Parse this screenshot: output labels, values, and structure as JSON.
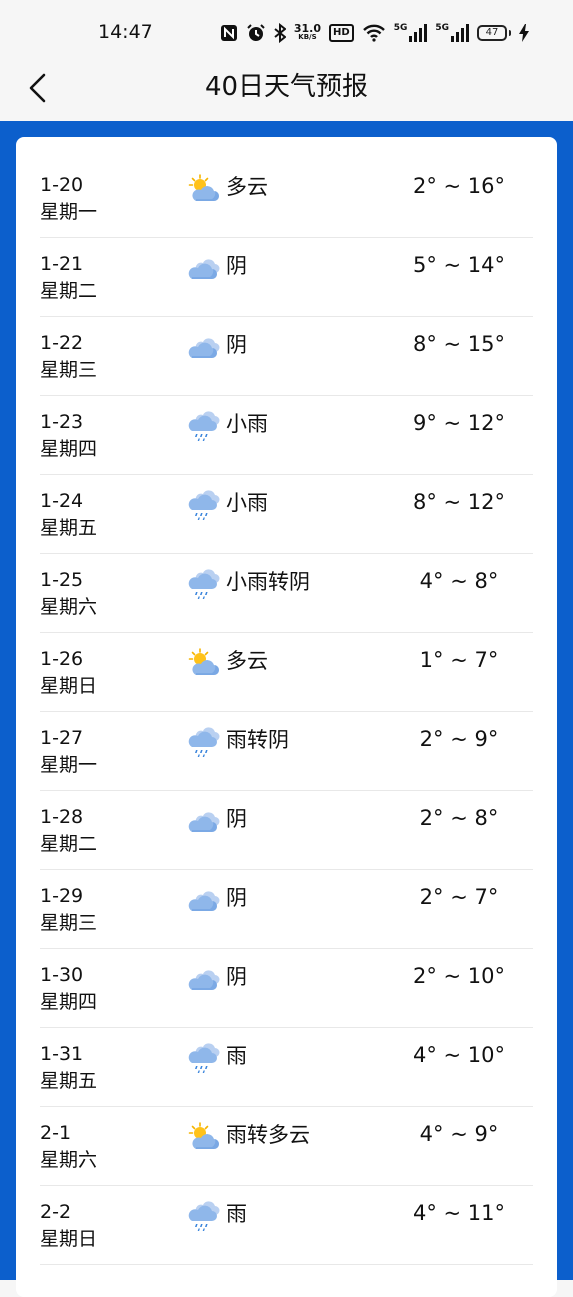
{
  "status_bar": {
    "time": "14:47",
    "net_speed_value": "31.0",
    "net_speed_unit": "KB/S",
    "hd_label": "HD",
    "signal1_label": "5G",
    "signal2_label": "5G",
    "battery_level": "47",
    "icons": [
      "nfc-icon",
      "alarm-icon",
      "bluetooth-icon",
      "wifi-icon",
      "charging-icon"
    ]
  },
  "header": {
    "title": "40日天气预报",
    "back_icon": "chevron-left-icon"
  },
  "colors": {
    "frame_blue": "#0c5fcc",
    "card_bg": "#ffffff",
    "divider": "#e8e8e8"
  },
  "forecast": [
    {
      "date": "1-20",
      "weekday": "星期一",
      "icon": "partly-cloudy",
      "condition": "多云",
      "temp": "2° ~ 16°"
    },
    {
      "date": "1-21",
      "weekday": "星期二",
      "icon": "overcast",
      "condition": "阴",
      "temp": "5° ~ 14°"
    },
    {
      "date": "1-22",
      "weekday": "星期三",
      "icon": "overcast",
      "condition": "阴",
      "temp": "8° ~ 15°"
    },
    {
      "date": "1-23",
      "weekday": "星期四",
      "icon": "rain",
      "condition": "小雨",
      "temp": "9° ~ 12°"
    },
    {
      "date": "1-24",
      "weekday": "星期五",
      "icon": "rain",
      "condition": "小雨",
      "temp": "8° ~ 12°"
    },
    {
      "date": "1-25",
      "weekday": "星期六",
      "icon": "rain",
      "condition": "小雨转阴",
      "temp": "4° ~ 8°"
    },
    {
      "date": "1-26",
      "weekday": "星期日",
      "icon": "partly-cloudy",
      "condition": "多云",
      "temp": "1° ~ 7°"
    },
    {
      "date": "1-27",
      "weekday": "星期一",
      "icon": "rain",
      "condition": "雨转阴",
      "temp": "2° ~ 9°"
    },
    {
      "date": "1-28",
      "weekday": "星期二",
      "icon": "overcast",
      "condition": "阴",
      "temp": "2° ~ 8°"
    },
    {
      "date": "1-29",
      "weekday": "星期三",
      "icon": "overcast",
      "condition": "阴",
      "temp": "2° ~ 7°"
    },
    {
      "date": "1-30",
      "weekday": "星期四",
      "icon": "overcast",
      "condition": "阴",
      "temp": "2° ~ 10°"
    },
    {
      "date": "1-31",
      "weekday": "星期五",
      "icon": "rain",
      "condition": "雨",
      "temp": "4° ~ 10°"
    },
    {
      "date": "2-1",
      "weekday": "星期六",
      "icon": "partly-cloudy",
      "condition": "雨转多云",
      "temp": "4° ~ 9°"
    },
    {
      "date": "2-2",
      "weekday": "星期日",
      "icon": "rain",
      "condition": "雨",
      "temp": "4° ~ 11°"
    }
  ]
}
